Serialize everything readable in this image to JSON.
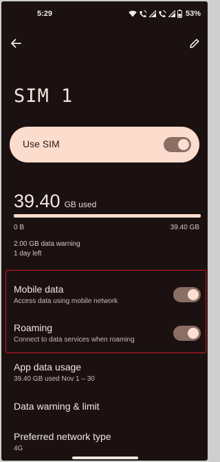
{
  "status_bar": {
    "time": "5:29",
    "battery": "53%"
  },
  "header": {
    "title": "SIM 1"
  },
  "use_sim": {
    "label": "Use SIM",
    "enabled": true
  },
  "usage": {
    "value": "39.40",
    "unit": "GB used",
    "bar_min": "0 B",
    "bar_max": "39.40 GB",
    "fill_fraction": 1.0,
    "warning": "2.00 GB data warning",
    "days_left": "1 day left"
  },
  "settings": {
    "mobile_data": {
      "title": "Mobile data",
      "subtitle": "Access data using mobile network",
      "enabled": true
    },
    "roaming": {
      "title": "Roaming",
      "subtitle": "Connect to data services when roaming",
      "enabled": true
    },
    "app_data_usage": {
      "title": "App data usage",
      "subtitle": "39.40 GB used Nov 1 – 30"
    },
    "data_warning_limit": {
      "title": "Data warning & limit"
    },
    "preferred_network": {
      "title": "Preferred network type",
      "subtitle": "4G"
    }
  },
  "colors": {
    "background": "#1b1110",
    "accent": "#fcdccd",
    "toggle_track": "#8b6e64",
    "highlight": "#d0182a"
  }
}
